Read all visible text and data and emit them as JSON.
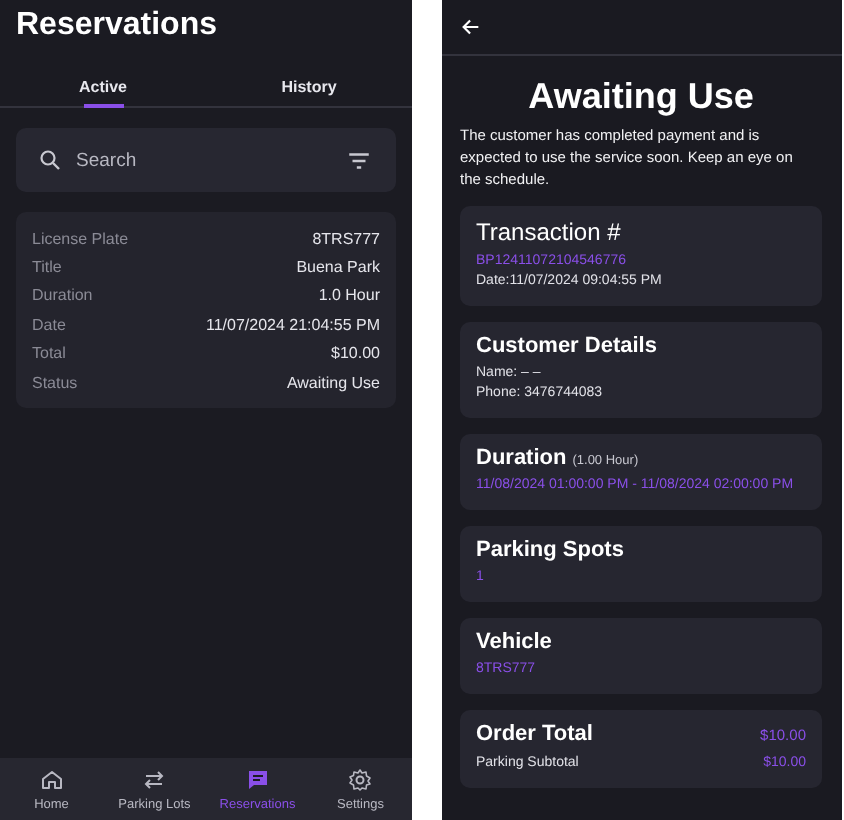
{
  "list_screen": {
    "title": "Reservations",
    "tabs": [
      {
        "label": "Active",
        "selected": true
      },
      {
        "label": "History",
        "selected": false
      }
    ],
    "search": {
      "placeholder": "Search"
    },
    "reservation": [
      {
        "label": "License Plate",
        "value": "8TRS777"
      },
      {
        "label": "Title",
        "value": "Buena Park"
      },
      {
        "label": "Duration",
        "value": "1.0 Hour"
      },
      {
        "label": "Date",
        "value": "11/07/2024 21:04:55 PM"
      },
      {
        "label": "Total",
        "value": "$10.00"
      },
      {
        "label": "Status",
        "value": "Awaiting Use"
      }
    ],
    "nav": [
      {
        "label": "Home",
        "selected": false
      },
      {
        "label": "Parking Lots",
        "selected": false
      },
      {
        "label": "Reservations",
        "selected": true
      },
      {
        "label": "Settings",
        "selected": false
      }
    ]
  },
  "detail_screen": {
    "status": "Awaiting Use",
    "description": "The customer has completed payment and is expected to use the service soon. Keep an eye on the schedule.",
    "cards": [
      {
        "kind": "info_light",
        "title": "Transaction #",
        "lines": [
          {
            "text": "BP12411072104546776",
            "accent": true
          },
          {
            "text": "Date:11/07/2024 09:04:55 PM",
            "accent": false
          }
        ]
      },
      {
        "kind": "info",
        "title": "Customer Details",
        "lines": [
          {
            "text": "Name: – –",
            "accent": false
          },
          {
            "text": "Phone: 3476744083",
            "accent": false
          }
        ]
      },
      {
        "kind": "info",
        "title": "Duration",
        "note": "(1.00 Hour)",
        "lines": [
          {
            "text": "11/08/2024 01:00:00 PM - 11/08/2024 02:00:00 PM",
            "accent": true
          }
        ]
      },
      {
        "kind": "info",
        "title": "Parking Spots",
        "lines": [
          {
            "text": "1",
            "accent": true
          }
        ]
      },
      {
        "kind": "info",
        "title": "Vehicle",
        "lines": [
          {
            "text": "8TRS777",
            "accent": true
          }
        ]
      },
      {
        "kind": "total",
        "title": "Order Total",
        "value": "$10.00",
        "rows": [
          {
            "label": "Parking Subtotal",
            "value": "$10.00"
          }
        ]
      }
    ]
  }
}
